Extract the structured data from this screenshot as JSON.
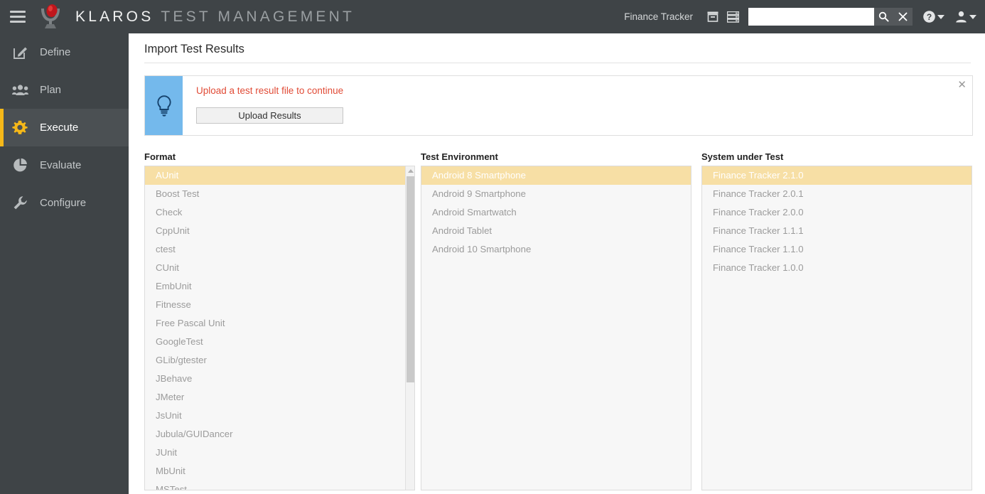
{
  "topbar": {
    "menu_icon": "hamburger-icon",
    "logo_icon": "klaros-logo-icon",
    "brand_primary": "KLAROS",
    "brand_secondary": "TEST MANAGEMENT",
    "project_name": "Finance Tracker",
    "archive_icon": "archive-box-icon",
    "servers_icon": "server-stack-icon",
    "search_value": "",
    "search_placeholder": "",
    "search_icon": "search-icon",
    "clear_icon": "close-icon",
    "help_icon": "help-circle-icon",
    "help_chevron_icon": "chevron-down-icon",
    "user_icon": "user-icon",
    "user_chevron_icon": "chevron-down-icon"
  },
  "sidebar": {
    "items": [
      {
        "label": "Define",
        "icon": "pencil-square-icon",
        "active": false
      },
      {
        "label": "Plan",
        "icon": "users-group-icon",
        "active": false
      },
      {
        "label": "Execute",
        "icon": "gear-icon",
        "active": true
      },
      {
        "label": "Evaluate",
        "icon": "pie-chart-icon",
        "active": false
      },
      {
        "label": "Configure",
        "icon": "wrench-icon",
        "active": false
      }
    ],
    "active_accent": "#f5b819"
  },
  "page": {
    "title": "Import Test Results"
  },
  "banner": {
    "icon": "lightbulb-icon",
    "icon_bg": "#74b9ec",
    "message": "Upload a test result file to continue",
    "message_color": "#e14b36",
    "upload_label": "Upload Results",
    "close_label": "✕"
  },
  "columns": {
    "format": {
      "label": "Format",
      "items": [
        "AUnit",
        "Boost Test",
        "Check",
        "CppUnit",
        "ctest",
        "CUnit",
        "EmbUnit",
        "Fitnesse",
        "Free Pascal Unit",
        "GoogleTest",
        "GLib/gtester",
        "JBehave",
        "JMeter",
        "JsUnit",
        "Jubula/GUIDancer",
        "JUnit",
        "MbUnit",
        "MSTest"
      ],
      "selected": "AUnit",
      "has_scrollbar": true
    },
    "test_environment": {
      "label": "Test Environment",
      "items": [
        "Android 8 Smartphone",
        "Android 9 Smartphone",
        "Android Smartwatch",
        "Android Tablet",
        "Android 10 Smartphone"
      ],
      "selected": "Android 8 Smartphone",
      "has_scrollbar": false
    },
    "system_under_test": {
      "label": "System under Test",
      "items": [
        "Finance Tracker 2.1.0",
        "Finance Tracker 2.0.1",
        "Finance Tracker 2.0.0",
        "Finance Tracker 1.1.1",
        "Finance Tracker 1.1.0",
        "Finance Tracker 1.0.0"
      ],
      "selected": "Finance Tracker 2.1.0",
      "has_scrollbar": false
    }
  },
  "colors": {
    "chrome_dark": "#3f4447",
    "selection": "#f7dfa5",
    "accent": "#f5b819",
    "error": "#e14b36",
    "info_blue": "#74b9ec"
  }
}
